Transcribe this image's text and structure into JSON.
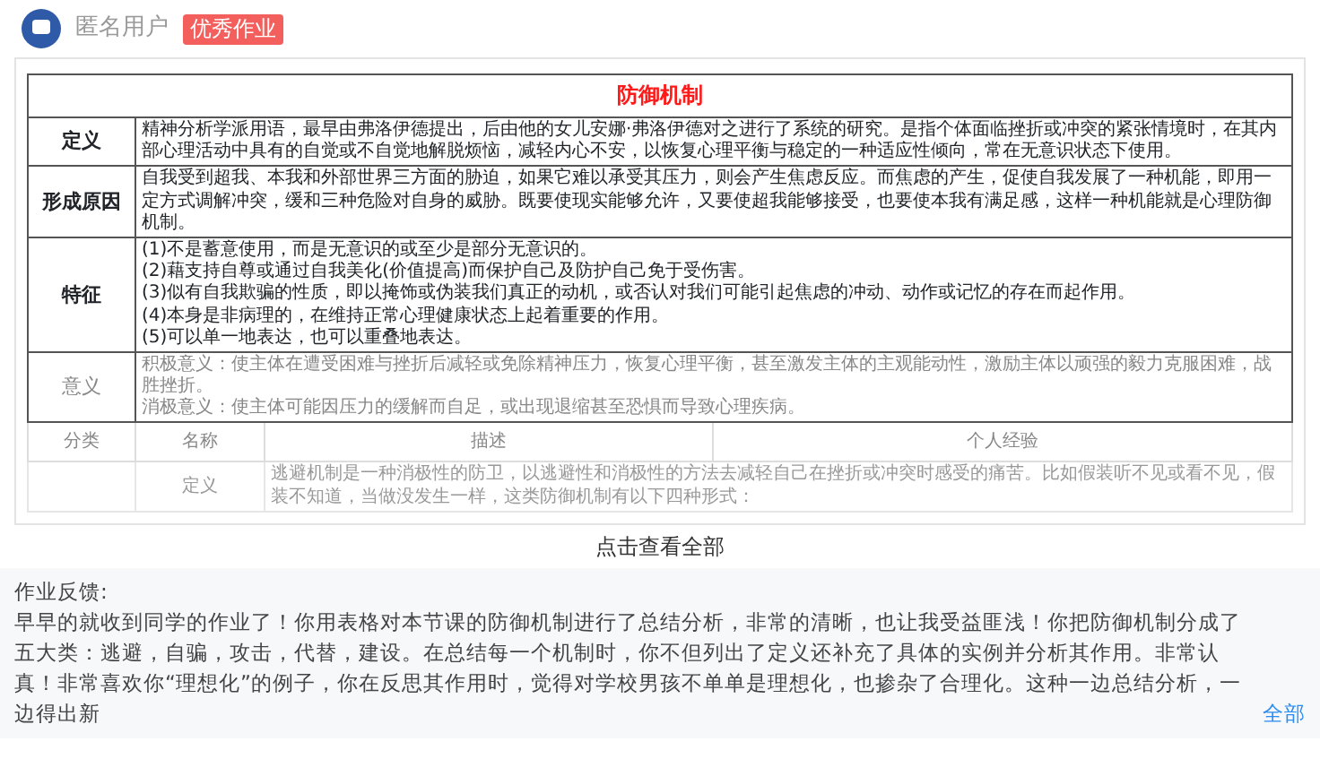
{
  "author": {
    "name": "匿名用户",
    "badge": "优秀作业"
  },
  "document": {
    "title": "防御机制",
    "rows": [
      {
        "label": "定义",
        "muted": false,
        "lines": [
          "精神分析学派用语，最早由弗洛伊德提出，后由他的女儿安娜·弗洛伊德对之进行了系统的研究。是指个体面临挫折或冲突的紧张情境时，在其内部心理活动中具有的自觉或不自觉地解脱烦恼，减轻内心不安，以恢复心理平衡与稳定的一种适应性倾向，常在无意识状态下使用。"
        ]
      },
      {
        "label": "形成原因",
        "muted": false,
        "lines": [
          "自我受到超我、本我和外部世界三方面的胁迫，如果它难以承受其压力，则会产生焦虑反应。而焦虑的产生，促使自我发展了一种机能，即用一定方式调解冲突，缓和三种危险对自身的威胁。既要使现实能够允许，又要使超我能够接受，也要使本我有满足感，这样一种机能就是心理防御机制。"
        ]
      },
      {
        "label": "特征",
        "muted": false,
        "lines": [
          "(1)不是蓄意使用，而是无意识的或至少是部分无意识的。",
          "(2)藉支持自尊或通过自我美化(价值提高)而保护自己及防护自己免于受伤害。",
          "(3)似有自我欺骗的性质，即以掩饰或伪装我们真正的动机，或否认对我们可能引起焦虑的冲动、动作或记忆的存在而起作用。",
          "(4)本身是非病理的，在维持正常心理健康状态上起着重要的作用。",
          "(5)可以单一地表达，也可以重叠地表达。"
        ]
      },
      {
        "label": "意义",
        "muted": true,
        "lines": [
          "积极意义：使主体在遭受困难与挫折后减轻或免除精神压力，恢复心理平衡，甚至激发主体的主观能动性，激励主体以顽强的毅力克服困难，战胜挫折。",
          "消极意义：使主体可能因压力的缓解而自足，或出现退缩甚至恐惧而导致心理疾病。"
        ]
      }
    ],
    "category_header": {
      "label": "分类",
      "columns": [
        "名称",
        "描述",
        "个人经验"
      ]
    },
    "category_row": {
      "name": "定义",
      "description": "逃避机制是一种消极性的防卫，以逃避性和消极性的方法去减轻自己在挫折或冲突时感受的痛苦。比如假装听不见或看不见，假装不知道，当做没发生一样，这类防御机制有以下四种形式："
    },
    "expand": "点击查看全部"
  },
  "feedback": {
    "heading": "作业反馈:",
    "text": "早早的就收到同学的作业了！你用表格对本节课的防御机制进行了总结分析，非常的清晰，也让我受益匪浅！你把防御机制分成了五大类：逃避，自骗，攻击，代替，建设。在总结每一个机制时，你不但列出了定义还补充了具体的实例并分析其作用。非常认真！非常喜欢你“理想化”的例子，你在反思其作用时，觉得对学校男孩不单单是理想化，也掺杂了合理化。这种一边总结分析，一边得出新",
    "more": "全部"
  }
}
